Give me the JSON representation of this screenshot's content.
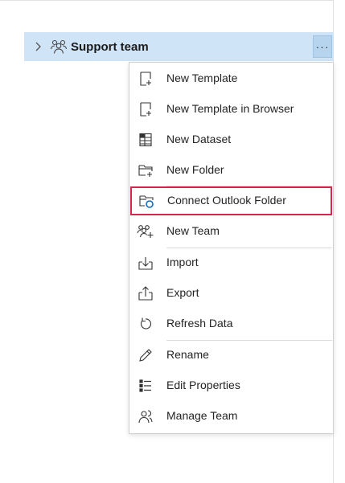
{
  "tree": {
    "team_label": "Support team",
    "more_label": "···"
  },
  "menu": {
    "items": [
      {
        "label": "New Template",
        "icon": "new-template-icon"
      },
      {
        "label": "New Template in Browser",
        "icon": "new-template-browser-icon"
      },
      {
        "label": "New Dataset",
        "icon": "dataset-icon"
      },
      {
        "label": "New Folder",
        "icon": "new-folder-icon"
      },
      {
        "label": "Connect Outlook Folder",
        "icon": "outlook-folder-icon"
      },
      {
        "label": "New Team",
        "icon": "new-team-icon"
      },
      {
        "label": "Import",
        "icon": "import-icon"
      },
      {
        "label": "Export",
        "icon": "export-icon"
      },
      {
        "label": "Refresh Data",
        "icon": "refresh-icon"
      },
      {
        "label": "Rename",
        "icon": "rename-icon"
      },
      {
        "label": "Edit Properties",
        "icon": "properties-icon"
      },
      {
        "label": "Manage Team",
        "icon": "manage-team-icon"
      }
    ]
  },
  "colors": {
    "row_selected": "#cfe4f7",
    "highlight_border": "#d4264f",
    "outlook_blue": "#0f6cbd"
  }
}
